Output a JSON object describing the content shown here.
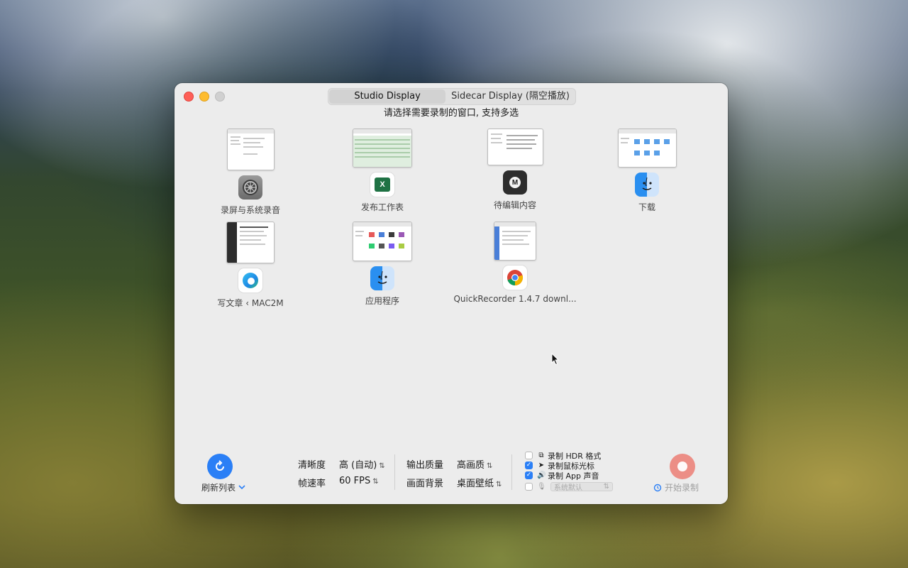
{
  "tabs": [
    {
      "label": "Studio Display",
      "active": true
    },
    {
      "label": "Sidecar Display (隔空播放)",
      "active": false
    }
  ],
  "instruction": "请选择需要录制的窗口, 支持多选",
  "windows": [
    {
      "label": "录屏与系统录音",
      "icon": "system-settings-icon"
    },
    {
      "label": "发布工作表",
      "icon": "excel-icon"
    },
    {
      "label": "待编辑内容",
      "icon": "markdown-editor-icon"
    },
    {
      "label": "下载",
      "icon": "finder-icon"
    },
    {
      "label": "写文章 ‹ MAC2M",
      "icon": "edge-icon"
    },
    {
      "label": "应用程序",
      "icon": "finder-icon"
    },
    {
      "label": "QuickRecorder 1.4.7 downl...",
      "icon": "chrome-icon"
    }
  ],
  "bottom": {
    "refresh_label": "刷新列表",
    "clarity_label": "清晰度",
    "clarity_value": "高 (自动)",
    "fps_label": "帧速率",
    "fps_value": "60 FPS",
    "quality_label": "输出质量",
    "quality_value": "高画质",
    "background_label": "画面背景",
    "background_value": "桌面壁纸",
    "options": [
      {
        "label": "录制 HDR 格式",
        "checked": false
      },
      {
        "label": "录制鼠标光标",
        "checked": true
      },
      {
        "label": "录制 App 声音",
        "checked": true
      }
    ],
    "mic_placeholder": "系统默认",
    "mic_checked": false,
    "start_label": "开始录制"
  },
  "colors": {
    "accent": "#2a7ff6",
    "record": "#ec8e86",
    "close": "#fe5f57",
    "minimize": "#febc2e"
  }
}
